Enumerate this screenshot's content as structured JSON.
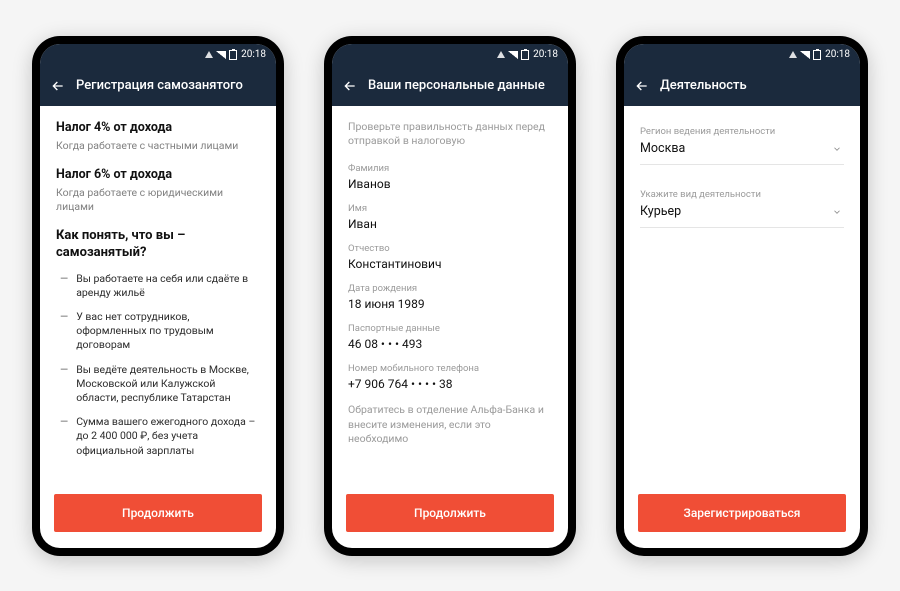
{
  "status": {
    "time": "20:18"
  },
  "screens": [
    {
      "title": "Регистрация самозанятого",
      "tax1_title": "Налог 4% от дохода",
      "tax1_sub": "Когда работаете с частными лицами",
      "tax2_title": "Налог 6% от дохода",
      "tax2_sub": "Когда работаете с юридическими лицами",
      "question": "Как понять, что вы – самозанятый?",
      "bullets": [
        "Вы работаете на себя или сдаёте в аренду жильё",
        "У вас нет сотрудников, оформленных по трудовым договорам",
        "Вы ведёте деятельность в Москве, Московской или Калужской области, республике Татарстан",
        "Сумма вашего ежегодного дохода – до 2 400 000 ₽, без учета официальной зарплаты"
      ],
      "cta": "Продолжить"
    },
    {
      "title": "Ваши персональные данные",
      "hint_top": "Проверьте правильность данных перед отправкой в налоговую",
      "fields": [
        {
          "label": "Фамилия",
          "value": "Иванов"
        },
        {
          "label": "Имя",
          "value": "Иван"
        },
        {
          "label": "Отчество",
          "value": "Константинович"
        },
        {
          "label": "Дата рождения",
          "value": "18 июня 1989"
        },
        {
          "label": "Паспортные данные",
          "value": "46 08 • • • 493"
        },
        {
          "label": "Номер мобильного телефона",
          "value": "+7 906 764 • • • • 38"
        }
      ],
      "hint_bottom": "Обратитесь в отделение Альфа-Банка и внесите изменения, если это необходимо",
      "cta": "Продолжить"
    },
    {
      "title": "Деятельность",
      "selects": [
        {
          "label": "Регион ведения деятельности",
          "value": "Москва"
        },
        {
          "label": "Укажите вид деятельности",
          "value": "Курьер"
        }
      ],
      "cta": "Зарегистрироваться"
    }
  ]
}
